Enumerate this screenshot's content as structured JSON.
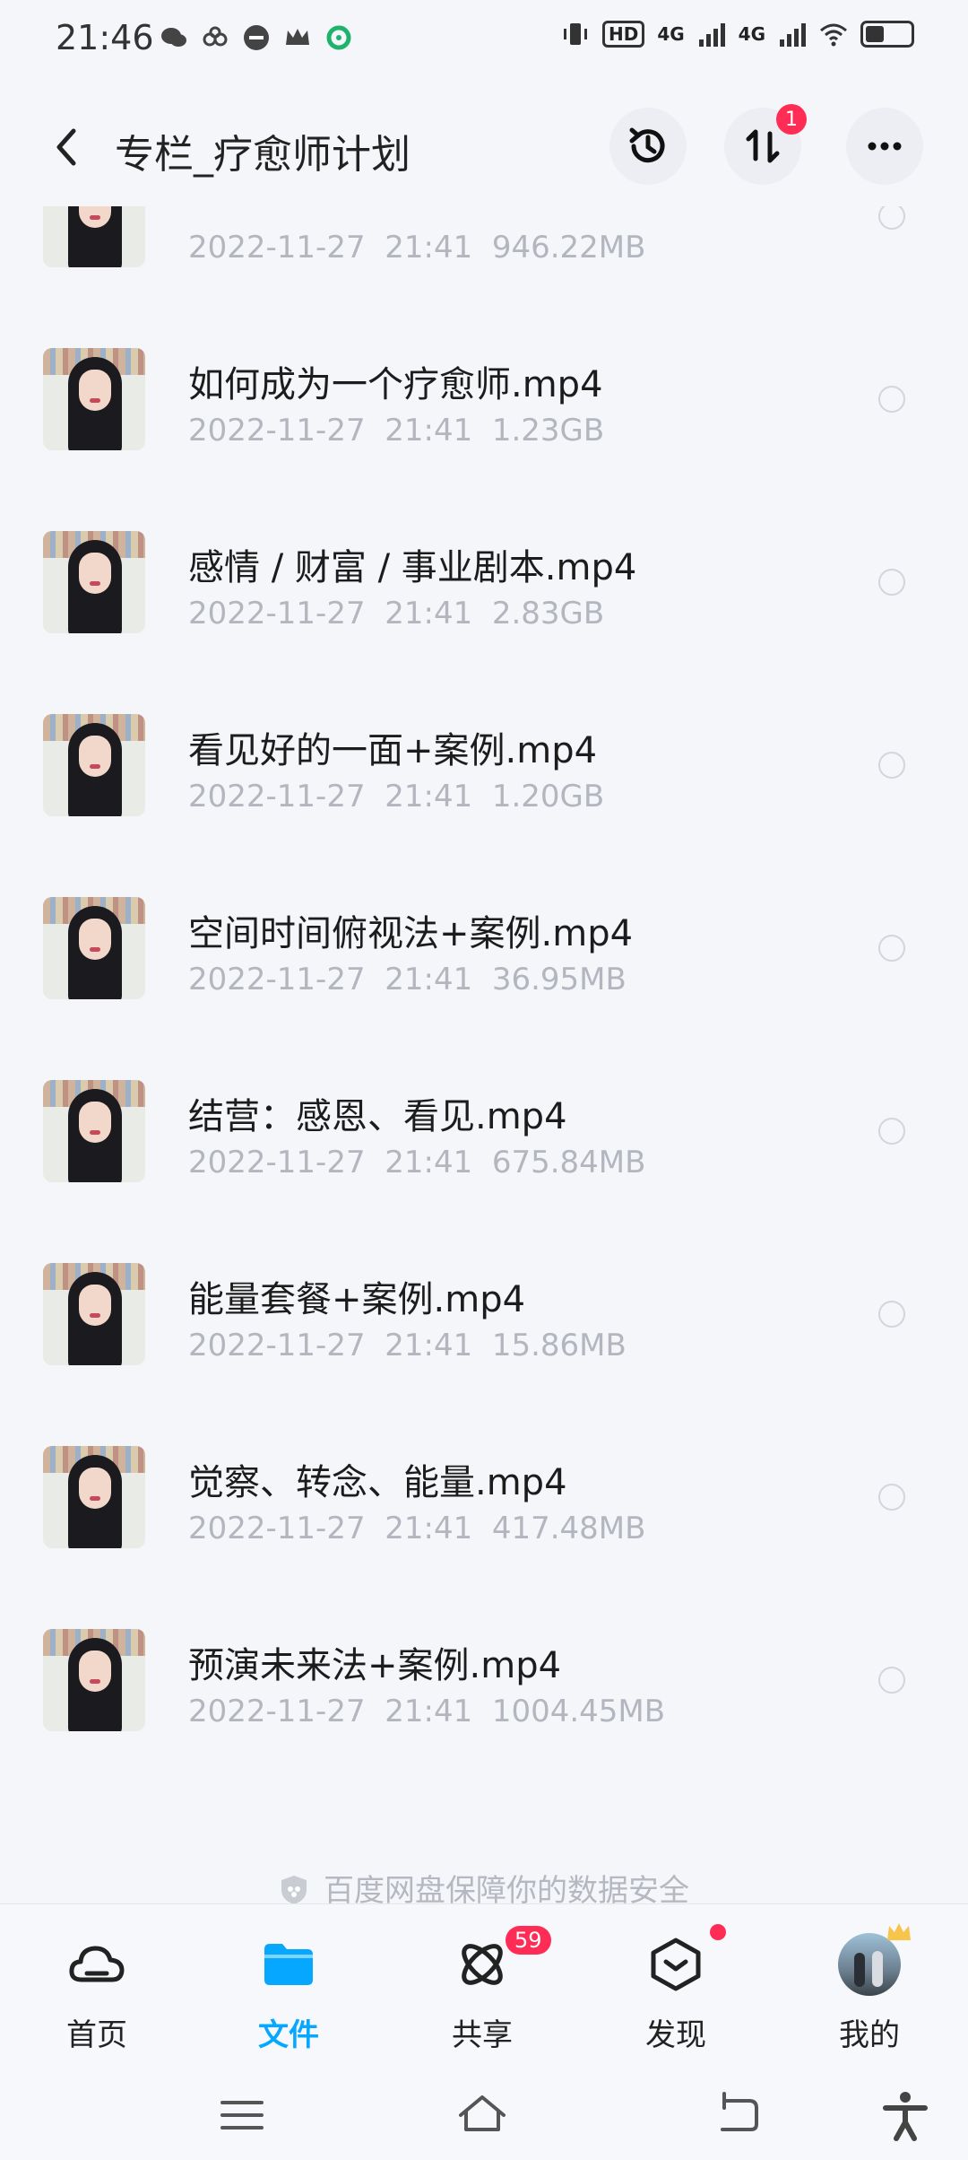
{
  "status_bar": {
    "time": "21:46",
    "left_icons": [
      "wechat-icon",
      "link-app-icon",
      "media-icon",
      "crown-icon",
      "green-app-icon"
    ],
    "right_icons": [
      "vibrate-icon",
      "hd-icon",
      "signal-4g-icon",
      "signal-4g-icon",
      "wifi-icon",
      "battery-icon"
    ],
    "network_1": "4G",
    "network_2": "4G",
    "hd": "HD"
  },
  "header": {
    "title": "专栏_疗愈师计划",
    "transfer_badge": "1"
  },
  "files": [
    {
      "name": "",
      "date": "2022-11-27",
      "time": "21:41",
      "size": "946.22MB"
    },
    {
      "name": "如何成为一个疗愈师.mp4",
      "date": "2022-11-27",
      "time": "21:41",
      "size": "1.23GB"
    },
    {
      "name": "感情 / 财富 / 事业剧本.mp4",
      "date": "2022-11-27",
      "time": "21:41",
      "size": "2.83GB"
    },
    {
      "name": "看见好的一面+案例.mp4",
      "date": "2022-11-27",
      "time": "21:41",
      "size": "1.20GB"
    },
    {
      "name": "空间时间俯视法+案例.mp4",
      "date": "2022-11-27",
      "time": "21:41",
      "size": "36.95MB"
    },
    {
      "name": "结营：感恩、看见.mp4",
      "date": "2022-11-27",
      "time": "21:41",
      "size": "675.84MB"
    },
    {
      "name": "能量套餐+案例.mp4",
      "date": "2022-11-27",
      "time": "21:41",
      "size": "15.86MB"
    },
    {
      "name": "觉察、转念、能量.mp4",
      "date": "2022-11-27",
      "time": "21:41",
      "size": "417.48MB"
    },
    {
      "name": "预演未来法+案例.mp4",
      "date": "2022-11-27",
      "time": "21:41",
      "size": "1004.45MB"
    }
  ],
  "safety_note": "百度网盘保障你的数据安全",
  "bottom_nav": {
    "home": "首页",
    "files": "文件",
    "share": "共享",
    "share_badge": "59",
    "discover": "发现",
    "mine": "我的"
  },
  "colors": {
    "accent": "#06a7ff",
    "badge": "#ff2d55",
    "meta_text": "#b3b6be",
    "background": "#f5f6fa"
  }
}
